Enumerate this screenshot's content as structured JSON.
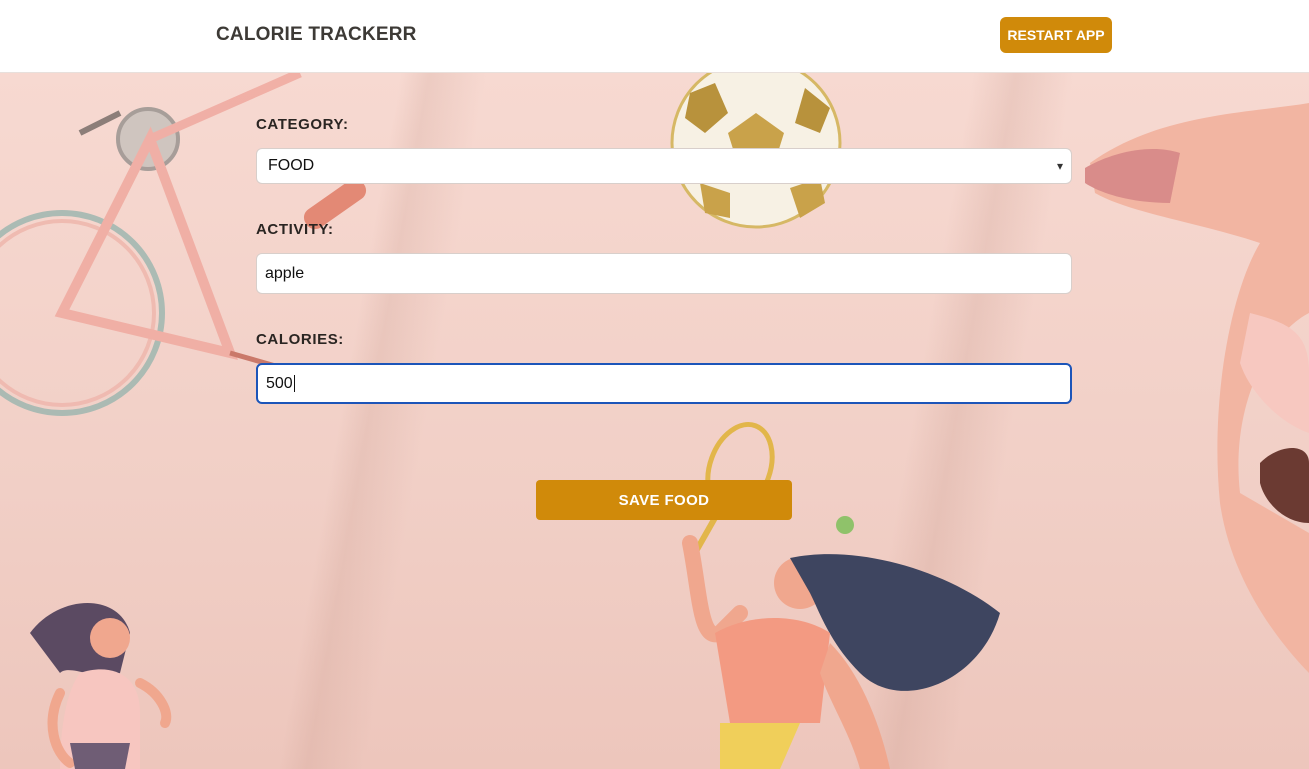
{
  "header": {
    "brand": "CALORIE TRACKERR",
    "restart_label": "RESTART APP"
  },
  "form": {
    "category_label": "CATEGORY:",
    "category_value": "FOOD",
    "activity_label": "ACTIVITY:",
    "activity_value": "apple",
    "calories_label": "CALORIES:",
    "calories_value": "500",
    "save_label": "SAVE FOOD"
  },
  "colors": {
    "accent": "#d08a0a",
    "focus": "#1c55b9",
    "background": "#f3d3ca"
  },
  "icons": {
    "category_dropdown": "chevron-down-icon"
  }
}
